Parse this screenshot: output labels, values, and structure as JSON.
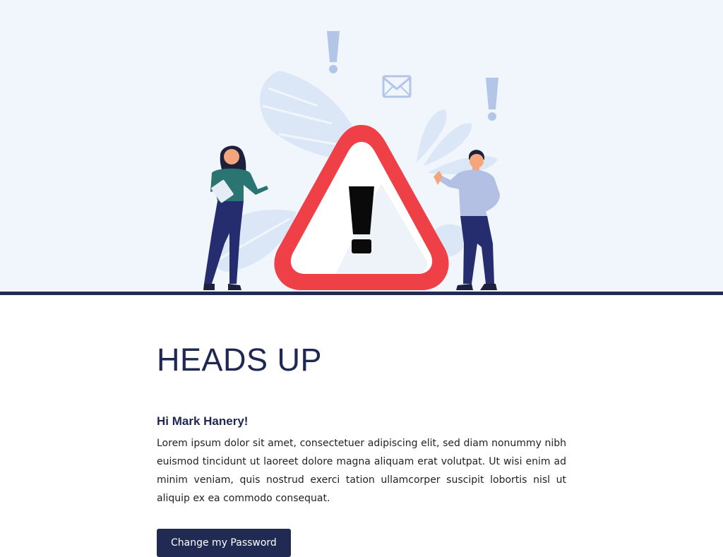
{
  "hero": {
    "illustration": "warning-illustration",
    "colors": {
      "background": "#f0f6fc",
      "rule": "#212a52",
      "warning_red": "#ef3f47",
      "accent_blue": "#b3c6e8"
    }
  },
  "email": {
    "title": "HEADS UP",
    "greeting": "Hi Mark Hanery!",
    "body": "Lorem ipsum dolor sit amet, consectetuer adipiscing elit, sed diam nonummy nibh euismod tincidunt ut laoreet dolore magna aliquam erat volutpat. Ut wisi enim ad minim veniam, quis nostrud exerci tation ullamcorper suscipit lobortis nisl ut aliquip ex ea commodo consequat.",
    "button_label": "Change my Password",
    "colors": {
      "heading": "#1f2753",
      "button_bg": "#212a52",
      "button_text": "#ffffff"
    }
  }
}
